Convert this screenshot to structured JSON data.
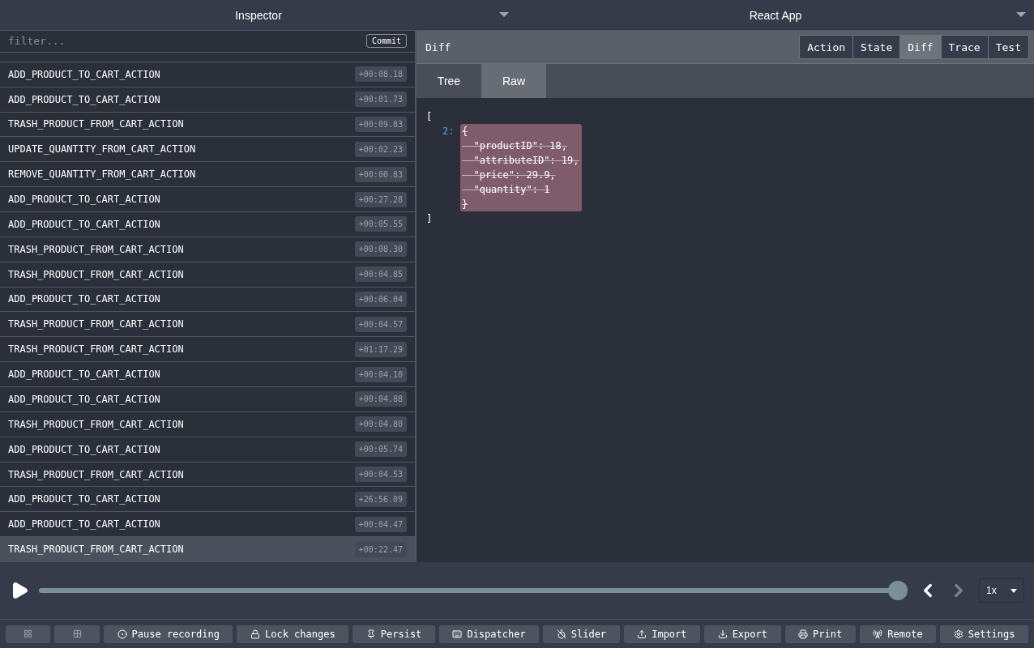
{
  "top_bar": {
    "monitor": "Inspector",
    "instance": "React App"
  },
  "filter": {
    "placeholder": "filter...",
    "commit": "Commit"
  },
  "actions": [
    {
      "name": "ADD_PRODUCT_TO_CART_ACTION",
      "time": "+00:08.18",
      "selected": false
    },
    {
      "name": "ADD_PRODUCT_TO_CART_ACTION",
      "time": "+00:01.73",
      "selected": false
    },
    {
      "name": "TRASH_PRODUCT_FROM_CART_ACTION",
      "time": "+00:09.83",
      "selected": false
    },
    {
      "name": "UPDATE_QUANTITY_FROM_CART_ACTION",
      "time": "+00:02.23",
      "selected": false
    },
    {
      "name": "REMOVE_QUANTITY_FROM_CART_ACTION",
      "time": "+00:00.83",
      "selected": false
    },
    {
      "name": "ADD_PRODUCT_TO_CART_ACTION",
      "time": "+00:27.28",
      "selected": false
    },
    {
      "name": "ADD_PRODUCT_TO_CART_ACTION",
      "time": "+00:05.55",
      "selected": false
    },
    {
      "name": "TRASH_PRODUCT_FROM_CART_ACTION",
      "time": "+00:08.30",
      "selected": false
    },
    {
      "name": "TRASH_PRODUCT_FROM_CART_ACTION",
      "time": "+00:04.85",
      "selected": false
    },
    {
      "name": "ADD_PRODUCT_TO_CART_ACTION",
      "time": "+00:06.04",
      "selected": false
    },
    {
      "name": "TRASH_PRODUCT_FROM_CART_ACTION",
      "time": "+00:04.57",
      "selected": false
    },
    {
      "name": "TRASH_PRODUCT_FROM_CART_ACTION",
      "time": "+01:17.29",
      "selected": false
    },
    {
      "name": "ADD_PRODUCT_TO_CART_ACTION",
      "time": "+00:04.10",
      "selected": false
    },
    {
      "name": "ADD_PRODUCT_TO_CART_ACTION",
      "time": "+00:04.88",
      "selected": false
    },
    {
      "name": "TRASH_PRODUCT_FROM_CART_ACTION",
      "time": "+00:04.80",
      "selected": false
    },
    {
      "name": "ADD_PRODUCT_TO_CART_ACTION",
      "time": "+00:05.74",
      "selected": false
    },
    {
      "name": "TRASH_PRODUCT_FROM_CART_ACTION",
      "time": "+00:04.53",
      "selected": false
    },
    {
      "name": "ADD_PRODUCT_TO_CART_ACTION",
      "time": "+26:56.09",
      "selected": false
    },
    {
      "name": "ADD_PRODUCT_TO_CART_ACTION",
      "time": "+00:04.47",
      "selected": false
    },
    {
      "name": "TRASH_PRODUCT_FROM_CART_ACTION",
      "time": "+00:22.47",
      "selected": true
    }
  ],
  "panel": {
    "title": "Diff",
    "tabs": [
      {
        "label": "Action",
        "selected": false
      },
      {
        "label": "State",
        "selected": false
      },
      {
        "label": "Diff",
        "selected": true
      },
      {
        "label": "Trace",
        "selected": false
      },
      {
        "label": "Test",
        "selected": false
      }
    ],
    "view_tabs": [
      {
        "label": "Tree",
        "selected": false
      },
      {
        "label": "Raw",
        "selected": true
      }
    ],
    "raw": {
      "open": "[",
      "key": "2:",
      "removed": {
        "open": "{",
        "entries": [
          "\"productID\": 18,",
          "\"attributeID\": 19,",
          "\"price\": 29.9,",
          "\"quantity\": 1"
        ],
        "close": "}"
      },
      "close": "]"
    }
  },
  "playback": {
    "level": 1,
    "prev_disabled": false,
    "next_disabled": true,
    "speed": "1x"
  },
  "toolbar": [
    "Pause recording",
    "Lock changes",
    "Persist",
    "Dispatcher",
    "Slider",
    "Import",
    "Export",
    "Print",
    "Remote",
    "Settings"
  ]
}
